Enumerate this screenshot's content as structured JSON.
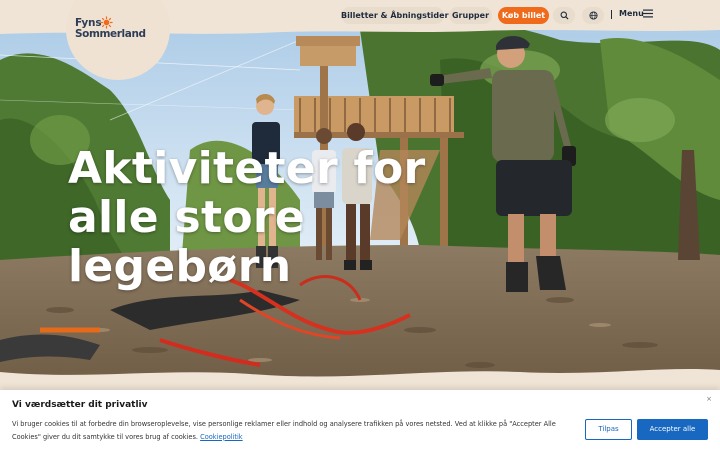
{
  "header": {
    "logo": {
      "line1": "Fyns",
      "line2": "Sommerland"
    },
    "nav": {
      "tickets_label": "Billetter & Åbningstider",
      "groups_label": "Grupper",
      "buy_label": "Køb billet",
      "menu_label": "Menu"
    },
    "icons": [
      "search-icon",
      "globe-icon",
      "hamburger-icon"
    ]
  },
  "hero": {
    "headline": [
      "Aktiviteter for",
      "alle store",
      "legebørn"
    ]
  },
  "cookie_banner": {
    "title": "Vi værdsætter dit privatliv",
    "text": "Vi bruger cookies til at forbedre din browseroplevelse, vise personlige reklamer eller indhold og analysere trafikken på vores netsted. Ved at klikke på \"Accepter Alle Cookies\" giver du dit samtykke til vores brug af cookies.",
    "policy_link": "Cookiepolitik",
    "customize_label": "Tilpas",
    "accept_label": "Accepter alle",
    "close_label": "×"
  },
  "colors": {
    "brand_navy": "#2f3d57",
    "accent_orange": "#ef6a1a",
    "cookie_blue": "#1867c0",
    "beige": "#efe4d6"
  }
}
